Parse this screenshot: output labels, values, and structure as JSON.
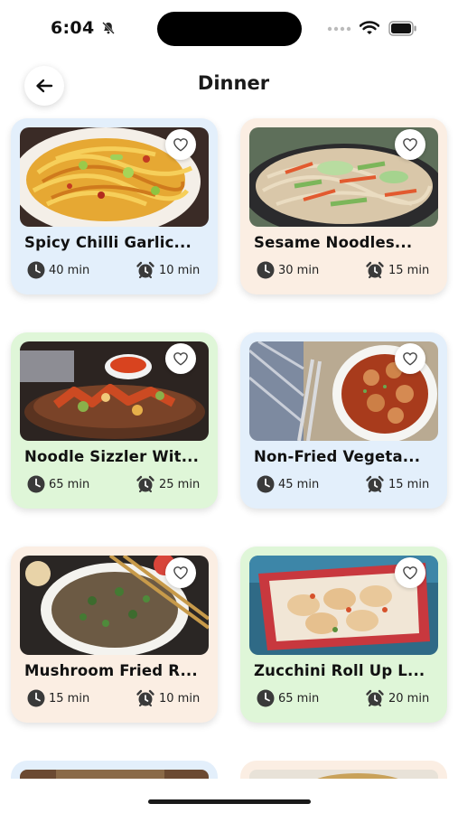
{
  "status": {
    "time": "6:04"
  },
  "header": {
    "title": "Dinner"
  },
  "colors": {
    "blue": "#e3effb",
    "peach": "#fbeee3",
    "green": "#dff6d8"
  },
  "recipes": [
    {
      "title": "Spicy Chilli Garlic...",
      "prep": "40 min",
      "cook": "10 min",
      "bg": "blue"
    },
    {
      "title": "Sesame Noodles...",
      "prep": "30 min",
      "cook": "15 min",
      "bg": "peach"
    },
    {
      "title": "Noodle Sizzler Wit...",
      "prep": "65 min",
      "cook": "25 min",
      "bg": "green"
    },
    {
      "title": "Non-Fried Vegeta...",
      "prep": "45 min",
      "cook": "15 min",
      "bg": "blue"
    },
    {
      "title": "Mushroom Fried R...",
      "prep": "15 min",
      "cook": "10 min",
      "bg": "peach"
    },
    {
      "title": "Zucchini Roll Up L...",
      "prep": "65 min",
      "cook": "20 min",
      "bg": "green"
    }
  ]
}
